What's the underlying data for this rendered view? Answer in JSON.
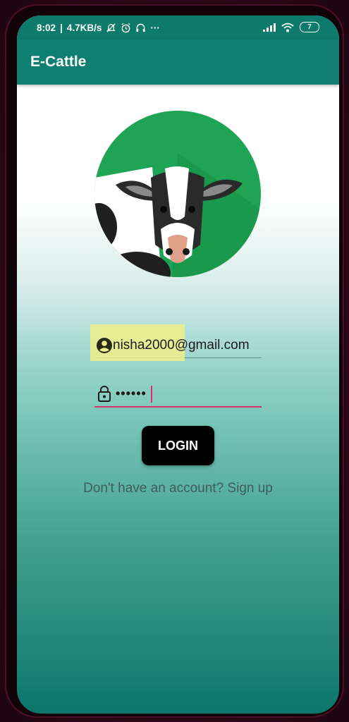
{
  "status_bar": {
    "time": "8:02",
    "network_speed": "4.7KB/s",
    "icons_left": [
      "mute-icon",
      "alarm-icon",
      "headphones-icon"
    ],
    "more": "···",
    "battery": "7"
  },
  "app_bar": {
    "title": "E-Cattle"
  },
  "form": {
    "email_value": "nisha2000@gmail.com",
    "password_value": "••••••",
    "login_label": "LOGIN",
    "signup_text": "Don't have an account? Sign up"
  },
  "colors": {
    "primary": "#0E7F70",
    "accent": "#D6336C",
    "button": "#020202",
    "logo_green": "#1FA354"
  }
}
